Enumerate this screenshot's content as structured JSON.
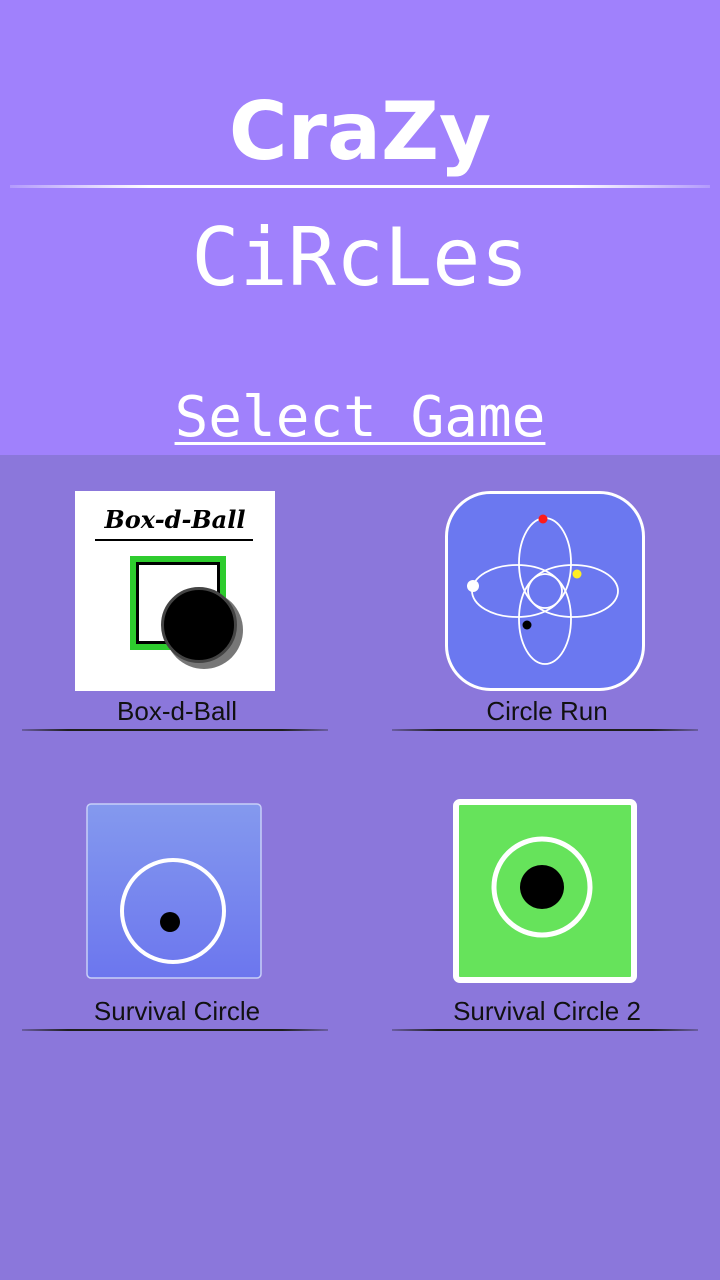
{
  "header": {
    "title_line1": "CraZy",
    "title_line2": "CiRcLes",
    "select_heading": "Select Game"
  },
  "games": [
    {
      "label": "Box-d-Ball",
      "icon": "box-d-ball-icon",
      "logo_text": "Box-d-Ball"
    },
    {
      "label": "Circle Run",
      "icon": "circle-run-icon"
    },
    {
      "label": "Survival Circle",
      "icon": "survival-circle-icon"
    },
    {
      "label": "Survival Circle 2",
      "icon": "survival-circle-2-icon"
    }
  ],
  "colors": {
    "header_bg": "#a081fc",
    "body_bg": "#8b77db",
    "box_green": "#2ecc2e",
    "circle_run_bg": "#6b78f0",
    "survival_bg": "#7e8ff0",
    "survival2_bg": "#66e35b"
  }
}
